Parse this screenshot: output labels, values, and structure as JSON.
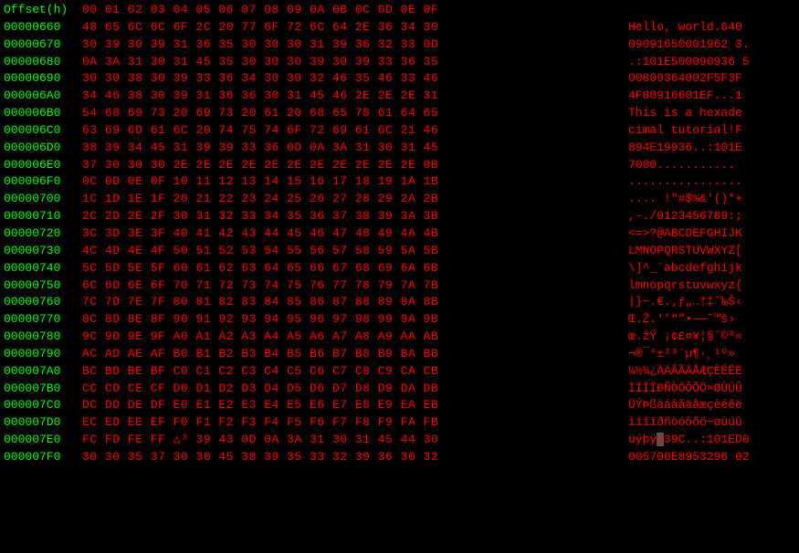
{
  "header": {
    "offset_label": "Offset(h)",
    "col_headers": "00 01 02 03 04 05 06 07 08 09 0A 0B 0C 0D 0E 0F"
  },
  "rows": [
    {
      "offset": "00000660",
      "hex": "48 65 6C 6C 6F 2C 20 77 6F 72 6C 64 2E 36 34 30",
      "ascii": "Hello, world.640"
    },
    {
      "offset": "00000670",
      "hex": "30 39 30 39 31 36 35 30 30 30 31 39 36 32 33 0D",
      "ascii": "09091650001962 3."
    },
    {
      "offset": "00000680",
      "hex": "0A 3A 31 30 31 45 35 30 30 30 39 30 39 33 36 35",
      "ascii": ".:101E500090936 5"
    },
    {
      "offset": "00000690",
      "hex": "30 30 38 30 39 33 36 34 30 30 32 46 35 46 33 46",
      "ascii": "00809364002F5F3F"
    },
    {
      "offset": "000006A0",
      "hex": "34 46 38 30 39 31 36 36 30 31 45 46 2E 2E 2E 31",
      "ascii": "4F80916601EF...1"
    },
    {
      "offset": "000006B0",
      "hex": "54 68 69 73 20 69 73 20 61 20 68 65 78 61 64 65",
      "ascii": "This is a hexade"
    },
    {
      "offset": "000006C0",
      "hex": "63 69 6D 61 6C 20 74 75 74 6F 72 69 61 6C 21 46",
      "ascii": "cimal tutorial!F"
    },
    {
      "offset": "000006D0",
      "hex": "38 39 34 45 31 39 39 33 36 0D 0A 3A 31 30 31 45",
      "ascii": "894E19936..:101E"
    },
    {
      "offset": "000006E0",
      "hex": "37 30 30 30 2E 2E 2E 2E 2E 2E 2E 2E 2E 2E 2E 0B",
      "ascii": "7000..........."
    },
    {
      "offset": "000006F0",
      "hex": "0C 0D 0E 0F 10 11 12 13 14 15 16 17 18 19 1A 1B",
      "ascii": "................"
    },
    {
      "offset": "00000700",
      "hex": "1C 1D 1E 1F 20 21 22 23 24 25 26 27 28 29 2A 2B",
      "ascii": ".... !\"#$%&'()*+"
    },
    {
      "offset": "00000710",
      "hex": "2C 2D 2E 2F 30 31 32 33 34 35 36 37 38 39 3A 3B",
      "ascii": ",-./0123456789:;"
    },
    {
      "offset": "00000720",
      "hex": "3C 3D 3E 3F 40 41 42 43 44 45 46 47 48 49 4A 4B",
      "ascii": "<=>?@ABCDEFGHIJK"
    },
    {
      "offset": "00000730",
      "hex": "4C 4D 4E 4F 50 51 52 53 54 55 56 57 58 59 5A 5B",
      "ascii": "LMNOPQRSTUVWXYZ["
    },
    {
      "offset": "00000740",
      "hex": "5C 5D 5E 5F 60 61 62 63 64 65 66 67 68 69 6A 6B",
      "ascii": "\\]^_`abcdefghijk"
    },
    {
      "offset": "00000750",
      "hex": "6C 6D 6E 6F 70 71 72 73 74 75 76 77 78 79 7A 7B",
      "ascii": "lmnopqrstuvwxyz{"
    },
    {
      "offset": "00000760",
      "hex": "7C 7D 7E 7F 80 81 82 83 84 85 86 87 88 89 8A 8B",
      "ascii": "|}~.€.‚ƒ„…†‡ˆ‰Š‹"
    },
    {
      "offset": "00000770",
      "hex": "8C 8D 8E 8F 90 91 92 93 94 95 96 97 98 99 9A 9B",
      "ascii": "Œ.Ž.‘’“”•–—˜™š›"
    },
    {
      "offset": "00000780",
      "hex": "9C 9D 9E 9F A0 A1 A2 A3 A4 A5 A6 A7 A8 A9 AA AB",
      "ascii": "œ.žŸ ¡¢£¤¥¦§¨©ª«"
    },
    {
      "offset": "00000790",
      "hex": "AC AD AE AF B0 B1 B2 B3 B4 B5 B6 B7 B8 B9 BA BB",
      "ascii": "¬­®¯°±²³´µ¶·¸¹º»"
    },
    {
      "offset": "000007A0",
      "hex": "BC BD BE BF C0 C1 C2 C3 C4 C5 C6 C7 C8 C9 CA CB",
      "ascii": "¼½¾¿ÀÁÂÃÄÅÆÇÈÉÊË"
    },
    {
      "offset": "000007B0",
      "hex": "CC CD CE CF D0 D1 D2 D3 D4 D5 D6 D7 D8 D9 DA DB",
      "ascii": "ÌÍÎÏÐÑÒÓÔÕÖ×ØÙÚÛ"
    },
    {
      "offset": "000007C0",
      "hex": "DC DD DE DF E0 E1 E2 E3 E4 E5 E6 E7 E8 E9 EA EB",
      "ascii": "ÜÝÞßàáâãäåæçèéêë"
    },
    {
      "offset": "000007D0",
      "hex": "EC ED EE EF F0 F1 F2 F3 F4 F5 F6 F7 F8 F9 FA FB",
      "ascii": "ìíîïðñòóôõö÷øùúû"
    },
    {
      "offset": "000007E0",
      "hex": "FC FD FE FF △³ 39 43 0D 0A 3A 31 30 31 45 44 30",
      "ascii": "üýþÿÿ39C..:101ED0",
      "cursor": true
    },
    {
      "offset": "000007F0",
      "hex": "30 30 35 37 30 30 45 38 39 35 33 32 39 36 30 32",
      "ascii": "005700E8953296 02"
    }
  ]
}
